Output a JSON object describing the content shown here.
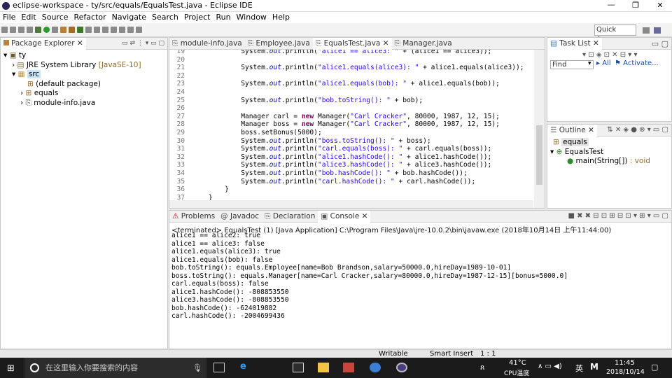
{
  "window": {
    "title": "eclipse-workspace - ty/src/equals/EqualsTest.java - Eclipse IDE"
  },
  "menu": [
    "File",
    "Edit",
    "Source",
    "Refactor",
    "Navigate",
    "Search",
    "Project",
    "Run",
    "Window",
    "Help"
  ],
  "quick_access": "Quick Access",
  "package_explorer": {
    "title": "Package Explorer",
    "items": [
      {
        "label": "ty"
      },
      {
        "label": "JRE System Library",
        "suffix": "[JavaSE-10]"
      },
      {
        "label": "src"
      },
      {
        "label": "(default package)"
      },
      {
        "label": "equals"
      },
      {
        "label": "module-info.java"
      }
    ]
  },
  "editor_tabs": [
    "module-info.java",
    "Employee.java",
    "EqualsTest.java",
    "Manager.java"
  ],
  "code": {
    "lines": [
      {
        "n": "19",
        "t": "        System.out.println(\"alice1 == alice3: \" + (alice1 == alice3));"
      },
      {
        "n": "20",
        "t": ""
      },
      {
        "n": "21",
        "t": "        System.out.println(\"alice1.equals(alice3): \" + alice1.equals(alice3));"
      },
      {
        "n": "22",
        "t": ""
      },
      {
        "n": "23",
        "t": "        System.out.println(\"alice1.equals(bob): \" + alice1.equals(bob));"
      },
      {
        "n": "24",
        "t": ""
      },
      {
        "n": "25",
        "t": "        System.out.println(\"bob.toString(): \" + bob);"
      },
      {
        "n": "26",
        "t": ""
      },
      {
        "n": "27",
        "t": "        Manager carl = new Manager(\"Carl Cracker\", 80000, 1987, 12, 15);"
      },
      {
        "n": "28",
        "t": "        Manager boss = new Manager(\"Carl Cracker\", 80000, 1987, 12, 15);"
      },
      {
        "n": "29",
        "t": "        boss.setBonus(5000);"
      },
      {
        "n": "30",
        "t": "        System.out.println(\"boss.toString(): \" + boss);"
      },
      {
        "n": "31",
        "t": "        System.out.println(\"carl.equals(boss): \" + carl.equals(boss));"
      },
      {
        "n": "32",
        "t": "        System.out.println(\"alice1.hashCode(): \" + alice1.hashCode());"
      },
      {
        "n": "33",
        "t": "        System.out.println(\"alice3.hashCode(): \" + alice3.hashCode());"
      },
      {
        "n": "34",
        "t": "        System.out.println(\"bob.hashCode(): \" + bob.hashCode());"
      },
      {
        "n": "35",
        "t": "        System.out.println(\"carl.hashCode(): \" + carl.hashCode());"
      },
      {
        "n": "36",
        "t": "    }"
      },
      {
        "n": "37",
        "t": "}"
      }
    ]
  },
  "task_list": {
    "title": "Task List",
    "find_placeholder": "Find",
    "all": "All",
    "activate": "Activate..."
  },
  "outline": {
    "title": "Outline",
    "items": [
      "equals",
      "EqualsTest",
      "main(String[])"
    ],
    "method_type": ": void"
  },
  "bottom_tabs": [
    "Problems",
    "Javadoc",
    "Declaration",
    "Console"
  ],
  "console": {
    "terminated": "<terminated> EqualsTest (1) [Java Application] C:\\Program Files\\Java\\jre-10.0.2\\bin\\javaw.exe (2018年10月14日 上午11:44:00)",
    "lines": [
      "alice1 == alice2: true",
      "alice1 == alice3: false",
      "alice1.equals(alice3): true",
      "alice1.equals(bob): false",
      "bob.toString(): equals.Employee[name=Bob Brandson,salary=50000.0,hireDay=1989-10-01]",
      "boss.toString(): equals.Manager[name=Carl Cracker,salary=80000.0,hireDay=1987-12-15][bonus=5000.0]",
      "carl.equals(boss): false",
      "alice1.hashCode(): -808853550",
      "alice3.hashCode(): -808853550",
      "bob.hashCode(): -624019882",
      "carl.hashCode(): -2004699436"
    ]
  },
  "status": {
    "writable": "Writable",
    "insert": "Smart Insert",
    "pos": "1 : 1"
  },
  "taskbar": {
    "search_placeholder": "在这里输入你要搜索的内容",
    "temp": "41°C",
    "temp_label": "CPU温度",
    "ime": "英",
    "time": "11:45",
    "date": "2018/10/14"
  },
  "colors": {
    "keyword": "#7f0055",
    "string": "#2a00ff",
    "field": "#0000c0",
    "accent": "#0078d7"
  }
}
